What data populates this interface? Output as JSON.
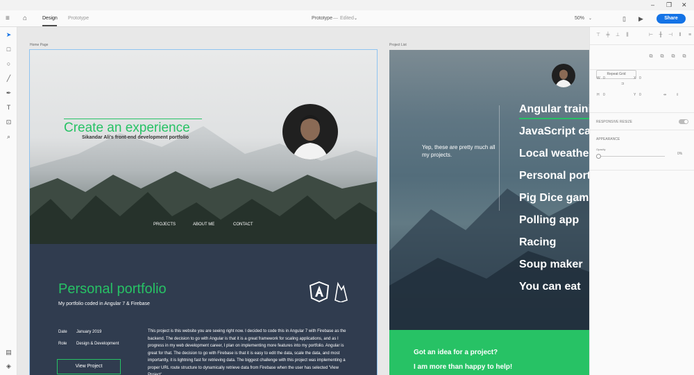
{
  "header": {
    "tabs": [
      "Design",
      "Prototype"
    ],
    "doc_title": "Prototype",
    "doc_status": "Edited",
    "zoom": "50%",
    "share": "Share"
  },
  "artboards": {
    "home_label": "Home Page",
    "list_label": "Project List"
  },
  "home": {
    "hero_title": "Create an experience",
    "hero_subtitle": "Sikandar Ali's front-end development portfolio",
    "nav": [
      "PROJECTS",
      "ABOUT ME",
      "CONTACT"
    ],
    "portfolio_title": "Personal portfolio",
    "portfolio_subtitle": "My portfolio coded in Angular 7 & Firebase",
    "date_label": "Date",
    "date_value": "January 2019",
    "role_label": "Role",
    "role_value": "Design & Development",
    "view_button": "View Project",
    "body": "This project is this website you are seeing right now. I decided to code this in Angular 7 with Firebase as the backend. The decision to go with Angular is that it is a great framework for scaling applications, and as I progress in my web development career, I plan on implementing more features into my portfolio.   Angular is great for that. The decision to go with Firebase is that it is easy to edit the data, scale the data, and most importantly, it is lightning fast for retrieving data. The biggest challenge with this project was implementing a proper URL route structure to dynamically retrieve data from Firebase when the user has selected 'View Project'."
  },
  "project_list": {
    "intro": "Yep, these are pretty much all my projects.",
    "items": [
      "Angular training",
      "JavaScript calculator",
      "Local weather",
      "Personal portfolio",
      "Pig Dice game",
      "Polling app",
      "Racing",
      "Soup maker",
      "You can eat"
    ],
    "cta_line1": "Got an idea for a project?",
    "cta_line2": "I am more than happy to help!"
  },
  "right_panel": {
    "repeat_grid": "Repeat Grid",
    "w_label": "W",
    "w_value": "0",
    "x_label": "X",
    "x_value": "0",
    "h_label": "H",
    "h_value": "0",
    "y_label": "Y",
    "y_value": "0",
    "responsive_resize": "RESPONSIVE RESIZE",
    "appearance": "APPEARANCE",
    "opacity_label": "Opacity",
    "opacity_value": "0%"
  },
  "colors": {
    "accent": "#27c265",
    "share": "#1473e6",
    "dark_section": "#303c4f"
  }
}
